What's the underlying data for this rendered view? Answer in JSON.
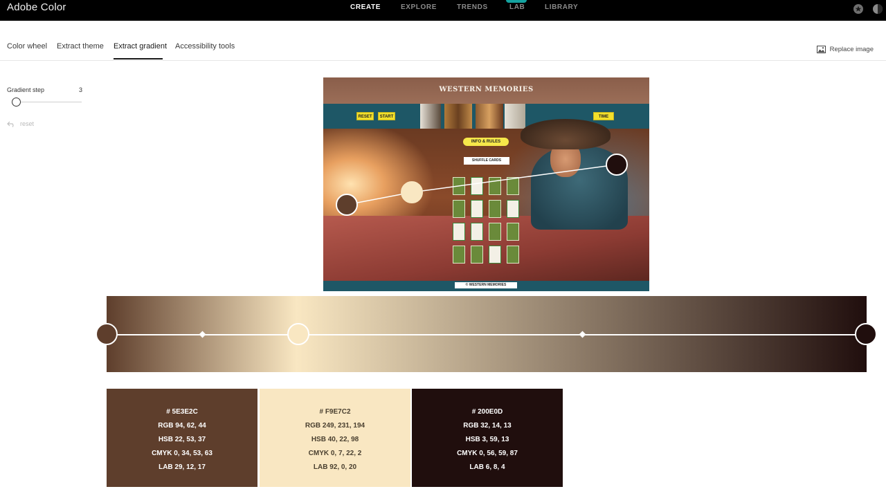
{
  "app": {
    "title": "Adobe Color"
  },
  "nav": {
    "items": [
      {
        "label": "CREATE",
        "active": true
      },
      {
        "label": "EXPLORE",
        "active": false
      },
      {
        "label": "TRENDS",
        "active": false
      },
      {
        "label": "LAB",
        "active": false
      },
      {
        "label": "LIBRARY",
        "active": false
      }
    ]
  },
  "tabs": [
    {
      "label": "Color wheel",
      "active": false
    },
    {
      "label": "Extract theme",
      "active": false
    },
    {
      "label": "Extract gradient",
      "active": true
    },
    {
      "label": "Accessibility tools",
      "active": false
    }
  ],
  "replace_image": {
    "label": "Replace image",
    "icon": "image-icon"
  },
  "sidebar": {
    "gradient_step_label": "Gradient step",
    "gradient_step_value": "3",
    "reset_label": "reset"
  },
  "image": {
    "title": "WESTERN MEMORIES",
    "buttons": {
      "reset": "RESET",
      "start": "START",
      "time": "TIME"
    },
    "info_pill": "INFO & RULES",
    "banner": "SHUFFLE CARDS",
    "footer": "© WESTERN MEMORIES"
  },
  "gradient": {
    "stops": [
      "#5E3E2C",
      "#F9E7C2",
      "#200E0D"
    ]
  },
  "swatches": [
    {
      "hex_label": "#   5E3E2C",
      "rgb": "RGB 94, 62, 44",
      "hsb": "HSB 22, 53, 37",
      "cmyk": "CMYK 0, 34, 53, 63",
      "lab": "LAB 29, 12, 17",
      "color": "#5E3E2C",
      "text_color": "#ffffff"
    },
    {
      "hex_label": "#   F9E7C2",
      "rgb": "RGB 249, 231, 194",
      "hsb": "HSB 40, 22, 98",
      "cmyk": "CMYK 0, 7, 22, 2",
      "lab": "LAB 92, 0, 20",
      "color": "#F9E7C2",
      "text_color": "#4a4030"
    },
    {
      "hex_label": "#   200E0D",
      "rgb": "RGB 32, 14, 13",
      "hsb": "HSB 3, 59, 13",
      "cmyk": "CMYK 0, 56, 59, 87",
      "lab": "LAB 6, 8, 4",
      "color": "#200E0D",
      "text_color": "#ffffff"
    }
  ]
}
